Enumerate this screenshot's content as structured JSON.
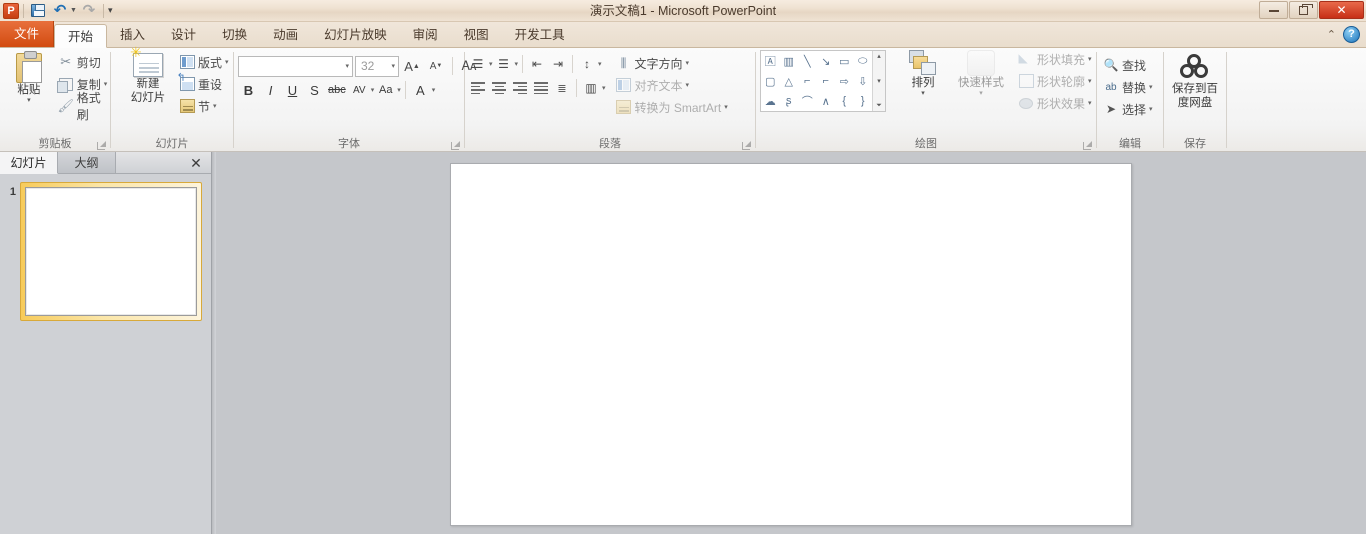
{
  "window": {
    "title": "演示文稿1  -  Microsoft PowerPoint",
    "app_logo": "powerpoint-logo",
    "minimize": "–",
    "restore": "❐",
    "close": "✕"
  },
  "quick_access": {
    "items": [
      {
        "name": "save-icon",
        "label": "保存"
      },
      {
        "name": "undo-icon",
        "label": "撤消",
        "glyph": "↶"
      },
      {
        "name": "redo-icon",
        "label": "恢复",
        "glyph": "↷"
      },
      {
        "name": "customize-qat-icon",
        "glyph": "▾"
      }
    ]
  },
  "tabs": [
    {
      "label": "文件",
      "id": "file",
      "active": false
    },
    {
      "label": "开始",
      "id": "home",
      "active": true
    },
    {
      "label": "插入",
      "id": "insert",
      "active": false
    },
    {
      "label": "设计",
      "id": "design",
      "active": false
    },
    {
      "label": "切换",
      "id": "transitions",
      "active": false
    },
    {
      "label": "动画",
      "id": "animations",
      "active": false
    },
    {
      "label": "幻灯片放映",
      "id": "slideshow",
      "active": false
    },
    {
      "label": "审阅",
      "id": "review",
      "active": false
    },
    {
      "label": "视图",
      "id": "view",
      "active": false
    },
    {
      "label": "开发工具",
      "id": "developer",
      "active": false
    }
  ],
  "tab_right": {
    "minimize_ribbon": "⌃",
    "help": "?"
  },
  "ribbon": {
    "clipboard": {
      "group_label": "剪贴板",
      "paste": {
        "label": "粘贴",
        "caret": "▾"
      },
      "cut": "剪切",
      "copy": "复制",
      "format_painter": "格式刷",
      "caret": "▾"
    },
    "slides": {
      "group_label": "幻灯片",
      "new_slide": {
        "line1": "新建",
        "line2": "幻灯片",
        "caret": "▾"
      },
      "layout": "版式",
      "reset": "重设",
      "section": "节",
      "caret": "▾"
    },
    "font": {
      "group_label": "字体",
      "font_name_value": "",
      "font_name_placeholder": "",
      "font_size_value": "32",
      "grow_font": "A",
      "shrink_font": "A",
      "clear_formatting": "A",
      "bold": "B",
      "italic": "I",
      "underline": "U",
      "shadow": "S",
      "strikethrough": "abc",
      "character_spacing": "AV",
      "change_case": "Aa",
      "font_color": "A",
      "caret": "▾"
    },
    "paragraph": {
      "group_label": "段落",
      "bullets": "☰",
      "numbering": "☰",
      "decrease_indent": "⇤",
      "increase_indent": "⇥",
      "line_spacing": "↕",
      "text_direction": "文字方向",
      "align_text": "对齐文本",
      "convert_smartart": "转换为 SmartArt",
      "align_left": "≡",
      "align_center": "≡",
      "align_right": "≡",
      "justify": "≡",
      "distributed": "≣",
      "columns": "▥",
      "caret": "▾"
    },
    "drawing": {
      "group_label": "绘图",
      "shapes": [
        "text-box-shape",
        "vertical-text-shape",
        "line-shape",
        "arrow-shape",
        "rectangle-shape",
        "ellipse-shape",
        "rounded-rectangle-shape",
        "triangle-shape",
        "elbow-connector-shape",
        "elbow-arrow-connector-shape",
        "right-arrow-shape",
        "down-arrow-shape",
        "cloud-shape",
        "scribble-shape",
        "arc-shape",
        "curve-shape",
        "left-brace-shape",
        "right-brace-shape"
      ],
      "scroll_up": "▴",
      "scroll_down": "▾",
      "scroll_more": "▾",
      "arrange": {
        "label": "排列",
        "caret": "▾"
      },
      "quick_styles": {
        "label": "快速样式",
        "caret": "▾"
      },
      "shape_fill": "形状填充",
      "shape_outline": "形状轮廓",
      "shape_effects": "形状效果",
      "caret": "▾"
    },
    "editing": {
      "group_label": "编辑",
      "find": "查找",
      "replace": "替换",
      "select": "选择",
      "caret": "▾"
    },
    "save": {
      "group_label": "保存",
      "baidu": {
        "line1": "保存到百",
        "line2": "度网盘"
      }
    }
  },
  "left_pane": {
    "tabs": [
      {
        "label": "幻灯片",
        "active": true
      },
      {
        "label": "大纲",
        "active": false
      }
    ],
    "close": "✕",
    "slides": [
      {
        "number": "1",
        "selected": true
      }
    ]
  },
  "main": {
    "slide_index": "1",
    "slide_content": ""
  },
  "colors": {
    "file_tab": "#d24b10",
    "title_bar": "#efe2d2",
    "ribbon_bg": "#f3f3f3",
    "workspace_bg": "#c5c7cb",
    "thumb_selected": "#f7cb5a",
    "close_button": "#c72f16",
    "help_button": "#1d74ba",
    "baidu_red": "#e03a52",
    "baidu_blue": "#2f8ed6"
  }
}
